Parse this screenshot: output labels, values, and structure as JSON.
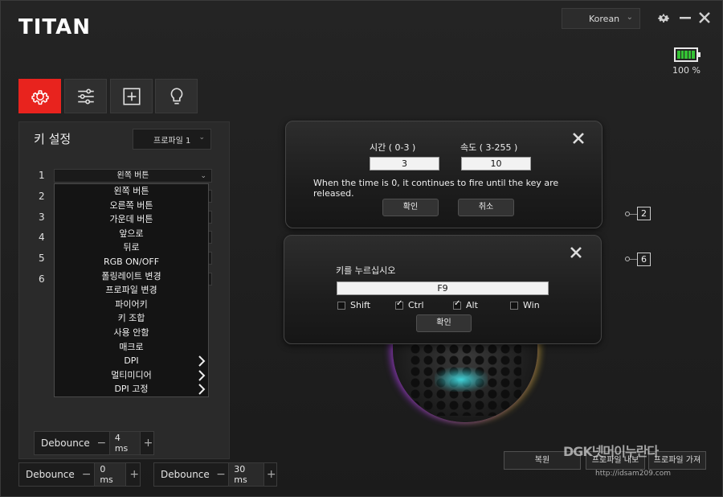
{
  "app": {
    "title": "TITAN",
    "language": "Korean",
    "battery_pct": "100 %",
    "battery_level": 1.0
  },
  "colors": {
    "accent": "#e8231e",
    "battery": "#34c234",
    "glow": "#3fd2d8"
  },
  "tabs": [
    {
      "icon": "gear-icon",
      "active": true
    },
    {
      "icon": "sliders-icon",
      "active": false
    },
    {
      "icon": "plus-square-icon",
      "active": false
    },
    {
      "icon": "lightbulb-icon",
      "active": false
    }
  ],
  "key_settings": {
    "title": "키 설정",
    "profile": "프로파일 1",
    "rows": [
      "1",
      "2",
      "3",
      "4",
      "5",
      "6"
    ],
    "selected": "왼쪽 버튼",
    "dropdown": [
      "왼쪽 버튼",
      "오른쪽 버튼",
      "가운데 버튼",
      "앞으로",
      "뒤로",
      "RGB ON/OFF",
      "폴링레이트 변경",
      "프로파일 변경",
      "파이어키",
      "키 조합",
      "사용 안함",
      "매크로",
      "DPI",
      "멀티미디어",
      "DPI 고정"
    ],
    "submenu_items": [
      "DPI",
      "멀티미디어",
      "DPI 고정"
    ]
  },
  "debounce": [
    {
      "label": "Debounce",
      "minus": "−",
      "value": "4 ms",
      "plus": "+"
    },
    {
      "label": "Debounce",
      "minus": "−",
      "value": "0 ms",
      "plus": "+"
    },
    {
      "label": "Debounce",
      "minus": "−",
      "value": "30 ms",
      "plus": "+"
    }
  ],
  "fire_dialog": {
    "time_label": "시간 ( 0-3 )",
    "time_value": "3",
    "speed_label": "속도 ( 3-255 )",
    "speed_value": "10",
    "note": "When the time is 0, it continues to fire until the key are released.",
    "ok": "확인",
    "cancel": "취소",
    "badge": "2"
  },
  "key_dialog": {
    "prompt": "키를 누르십시오",
    "key_value": "F9",
    "modifiers": [
      {
        "label": "Shift",
        "checked": false
      },
      {
        "label": "Ctrl",
        "checked": true
      },
      {
        "label": "Alt",
        "checked": true
      },
      {
        "label": "Win",
        "checked": false
      }
    ],
    "ok": "확인",
    "badge": "6"
  },
  "bottom_buttons": {
    "restore": "복원",
    "profile_export": "프로파일 내보",
    "profile_import": "프로파일 가져"
  },
  "watermark": {
    "text": "DGK넷머이누란다",
    "url": "http://idsam209.com"
  }
}
